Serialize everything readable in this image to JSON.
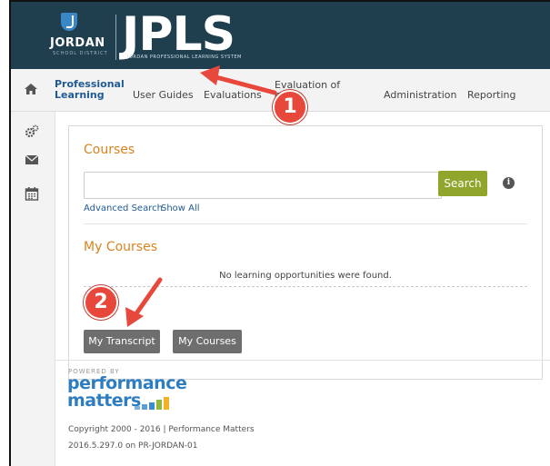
{
  "header": {
    "logo_org": "JORDAN",
    "logo_district": "SCHOOL DISTRICT",
    "logo_app": "JPLS",
    "logo_tagline": "JORDAN PROFESSIONAL LEARNING SYSTEM"
  },
  "nav": {
    "items": [
      {
        "label_line1": "Professional",
        "label_line2": "Learning"
      },
      {
        "label": "User Guides"
      },
      {
        "label": "Evaluations"
      },
      {
        "label_line1": "Evaluation of",
        "label_line2": "C"
      },
      {
        "label": "Administration"
      },
      {
        "label": "Reporting"
      }
    ]
  },
  "courses": {
    "title": "Courses",
    "search_value": "",
    "search_placeholder": "",
    "search_button": "Search",
    "info_glyph": "i",
    "advanced_search": "Advanced Search",
    "show_all": "Show All"
  },
  "my_courses": {
    "title": "My Courses",
    "empty_message": "No learning opportunities were found.",
    "transcript_button": "My Transcript",
    "my_courses_button": "My Courses"
  },
  "footer": {
    "powered_by": "POWERED BY",
    "brand_line1": "performance",
    "brand_line2": "matters",
    "copyright": "Copyright 2000 - 2016 | Performance Matters",
    "version": "2016.5.297.0 on PR-JORDAN-01"
  },
  "callouts": {
    "step1": "1",
    "step2": "2"
  },
  "colors": {
    "header_bg": "#1f3e4e",
    "accent_orange": "#d9831f",
    "search_green": "#8fa52b",
    "link_blue": "#1f5a93",
    "callout_red": "#e8473b"
  },
  "icons": [
    "home-icon",
    "gears-icon",
    "envelope-icon",
    "calendar-icon",
    "info-icon"
  ]
}
